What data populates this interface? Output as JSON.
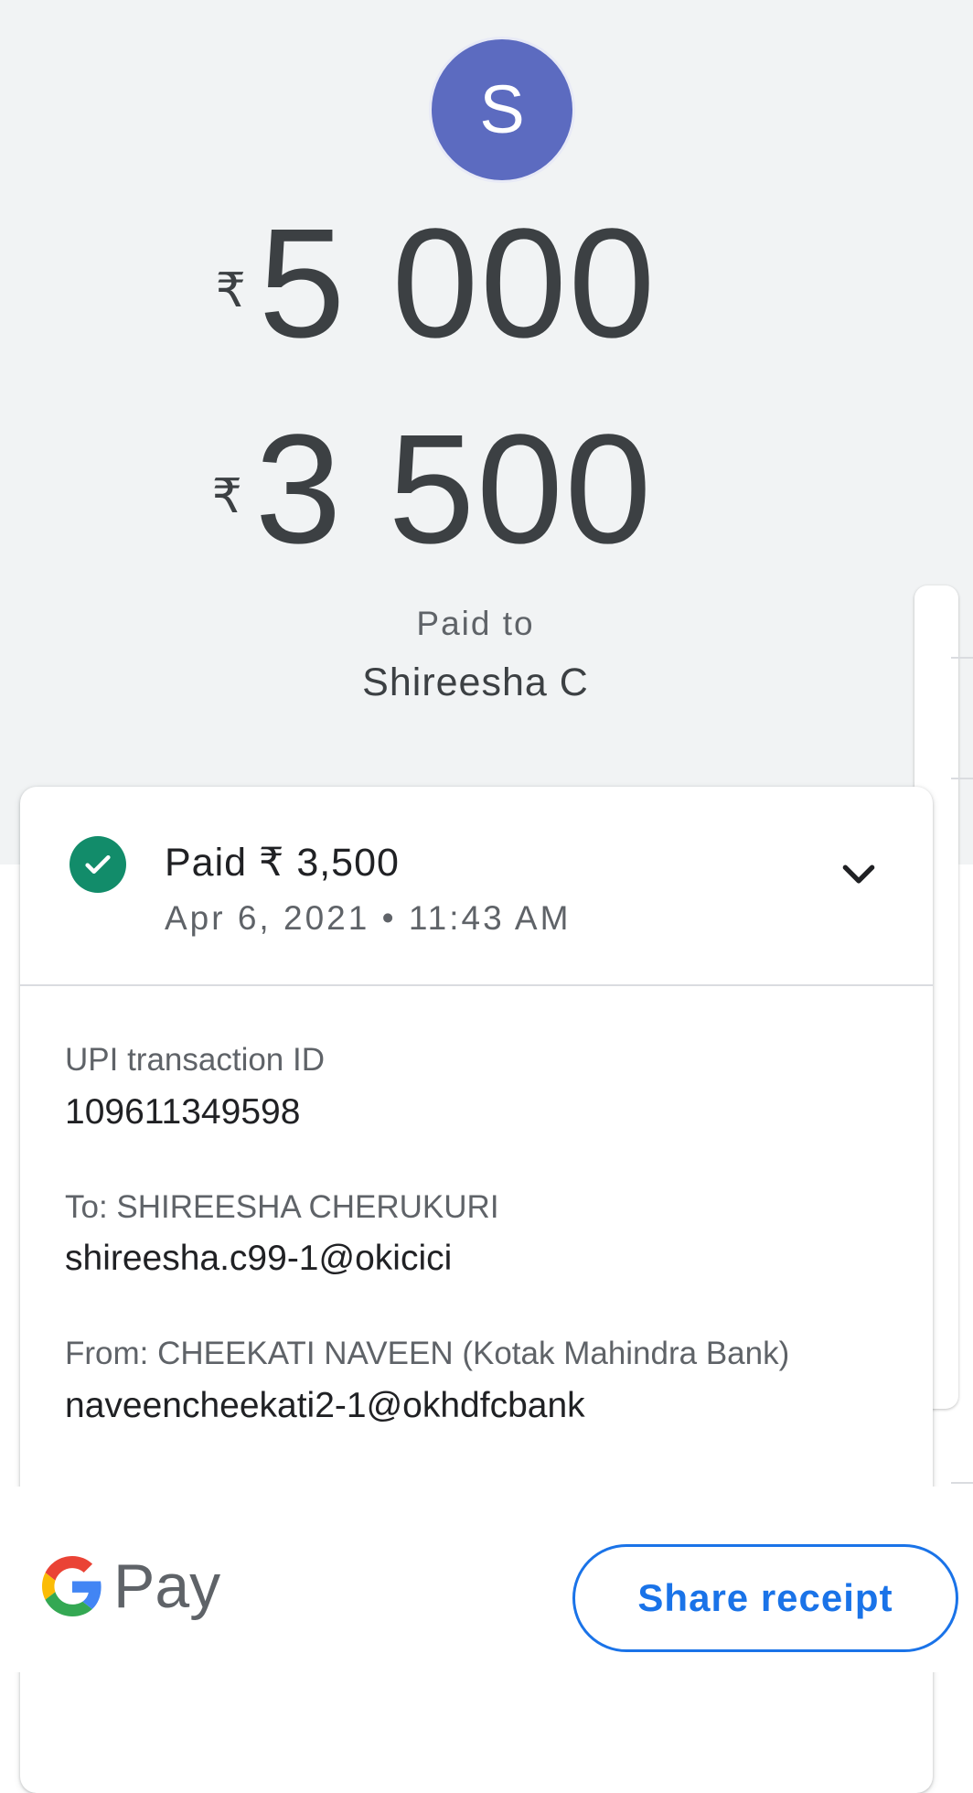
{
  "payee": {
    "avatar_letter": "S",
    "paid_to_label": "Paid to",
    "name": "Shireesha C"
  },
  "amounts": {
    "currency_symbol": "₹",
    "requested": "5 000",
    "paid": "3 500"
  },
  "transaction": {
    "status_text": "Paid ₹ 3,500",
    "datetime": "Apr 6, 2021 • 11:43 AM",
    "status": "success",
    "expanded": true,
    "upi_id_label": "UPI transaction ID",
    "upi_id": "109611349598",
    "to_label": "To: SHIREESHA CHERUKURI",
    "to_vpa": "shireesha.c99-1@okicici",
    "from_label": "From: CHEEKATI  NAVEEN (Kotak Mahindra Bank)",
    "from_vpa": "naveencheekati2-1@okhdfcbank"
  },
  "footer": {
    "brand_word": "Pay",
    "share_label": "Share receipt"
  },
  "colors": {
    "avatar_bg": "#5c6bc0",
    "success_green": "#128c6a",
    "accent_blue": "#1a73e8",
    "header_bg": "#f1f3f4"
  },
  "icons": {
    "status": "check-circle-icon",
    "expand": "chevron-down-icon",
    "brand": "google-g-logo-icon"
  }
}
